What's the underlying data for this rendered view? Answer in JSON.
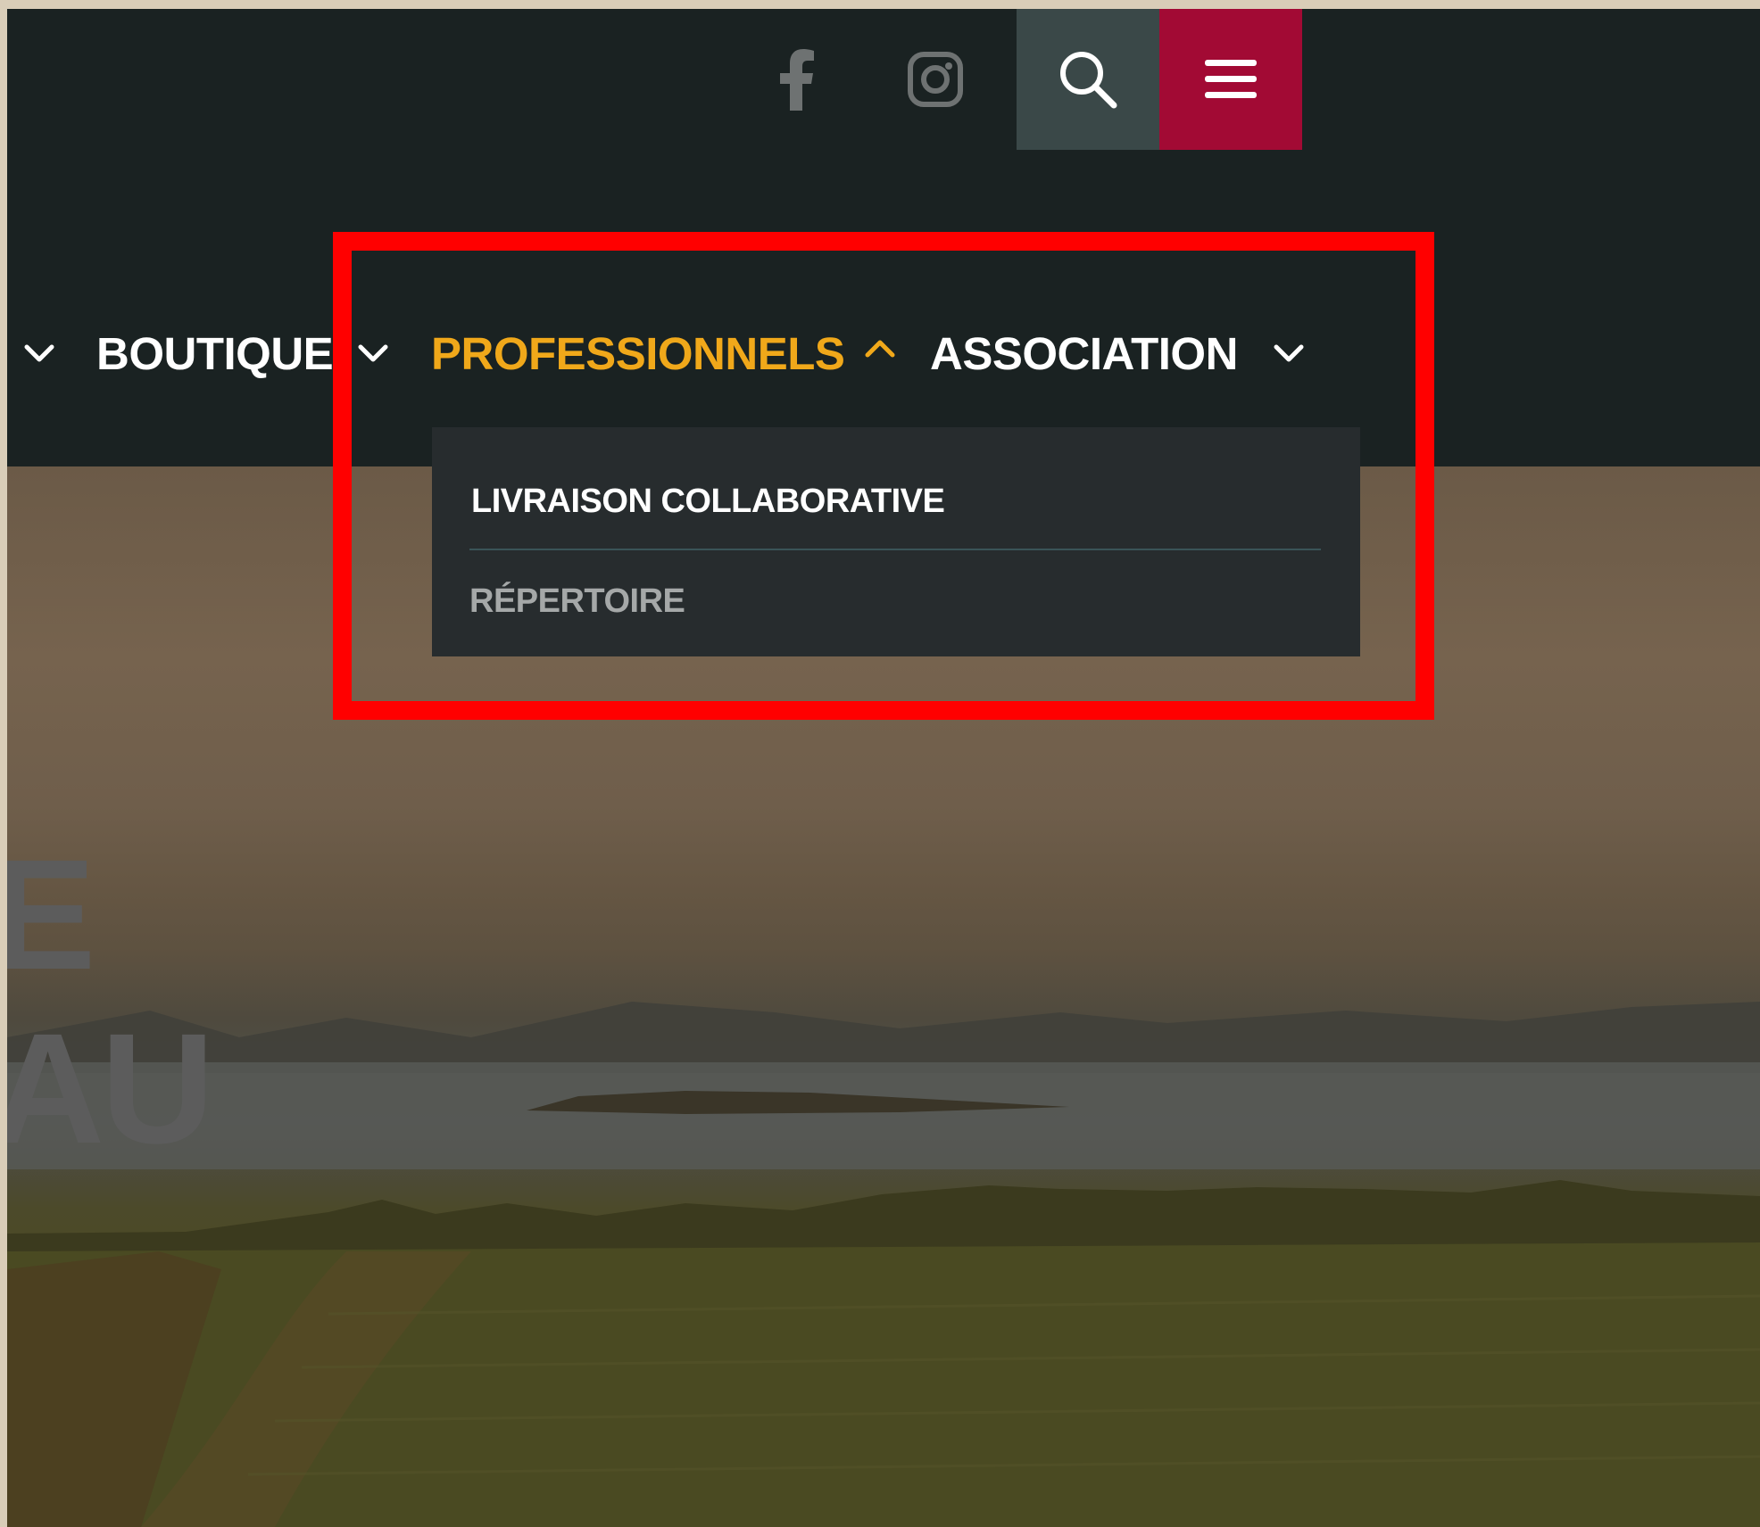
{
  "header": {
    "icons": {
      "facebook": "facebook-icon",
      "instagram": "instagram-icon",
      "search": "search-icon",
      "menu": "hamburger-menu-icon"
    }
  },
  "nav": {
    "items": [
      {
        "label": "BOUTIQUE",
        "expanded": false
      },
      {
        "label": "PROFESSIONNELS",
        "expanded": true
      },
      {
        "label": "ASSOCIATION",
        "expanded": false
      }
    ]
  },
  "dropdown": {
    "items": [
      {
        "label": "LIVRAISON COLLABORATIVE"
      },
      {
        "label": "RÉPERTOIRE"
      }
    ]
  },
  "hero": {
    "words": [
      "E",
      "AU"
    ]
  },
  "colors": {
    "header_bg": "#1a2222",
    "accent_yellow": "#f0a81a",
    "menu_red": "#a20a34",
    "search_bg": "#3a4848",
    "dropdown_bg": "#272c2e",
    "highlight": "#ff0000"
  }
}
